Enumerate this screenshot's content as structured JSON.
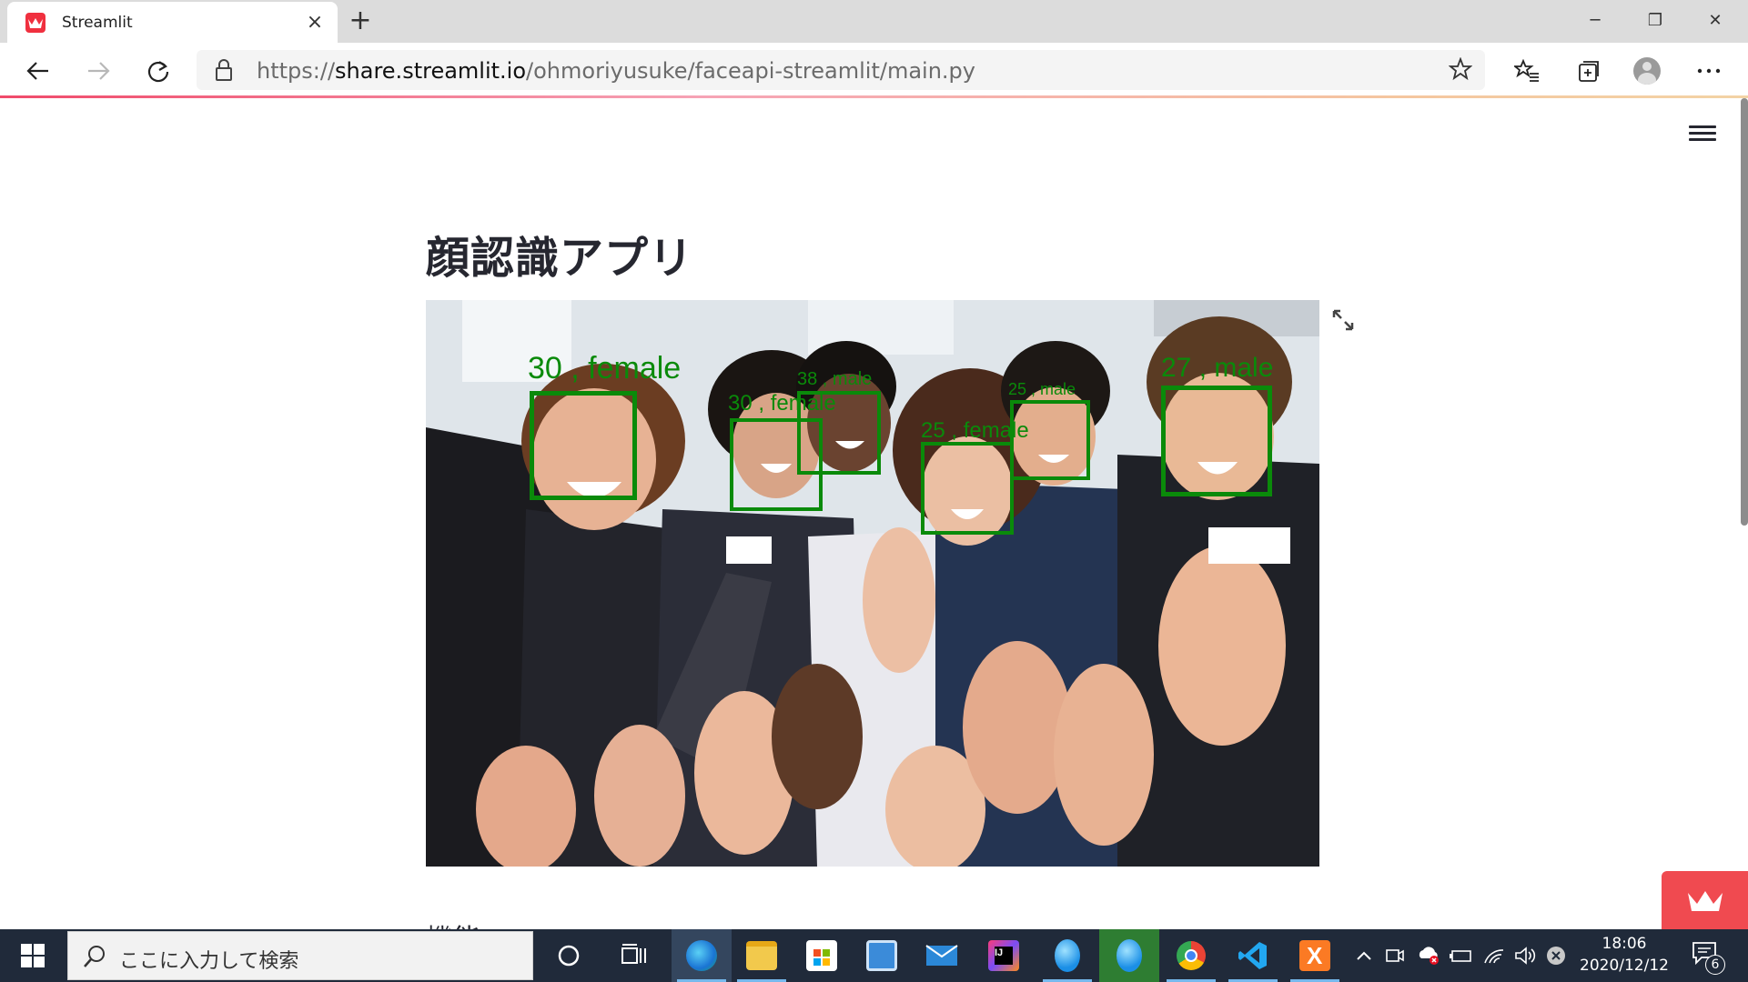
{
  "browser": {
    "tab_title": "Streamlit",
    "tab_close": "×",
    "new_tab": "+",
    "url_prefix": "https://",
    "url_host": "share.streamlit.io",
    "url_path": "/ohmoriyusuke/faceapi-streamlit/main.py",
    "window_controls": {
      "minimize": "─",
      "restore": "❐",
      "close": "✕"
    }
  },
  "page": {
    "title": "顔認識アプリ",
    "next_heading": "機能",
    "faces": [
      {
        "label": "30 , female"
      },
      {
        "label": "30 , female"
      },
      {
        "label": "38 , male"
      },
      {
        "label": "25 , female"
      },
      {
        "label": "25 , male"
      },
      {
        "label": "27 , male"
      }
    ],
    "box_color": "#0a8a0a"
  },
  "taskbar": {
    "search_placeholder": "ここに入力して検索",
    "clock_time": "18:06",
    "clock_date": "2020/12/12",
    "notification_count": "6"
  },
  "colors": {
    "streamlit_red": "#f04a50",
    "accent_pink": "#f04a6a",
    "taskbar_bg": "#202a3a"
  }
}
